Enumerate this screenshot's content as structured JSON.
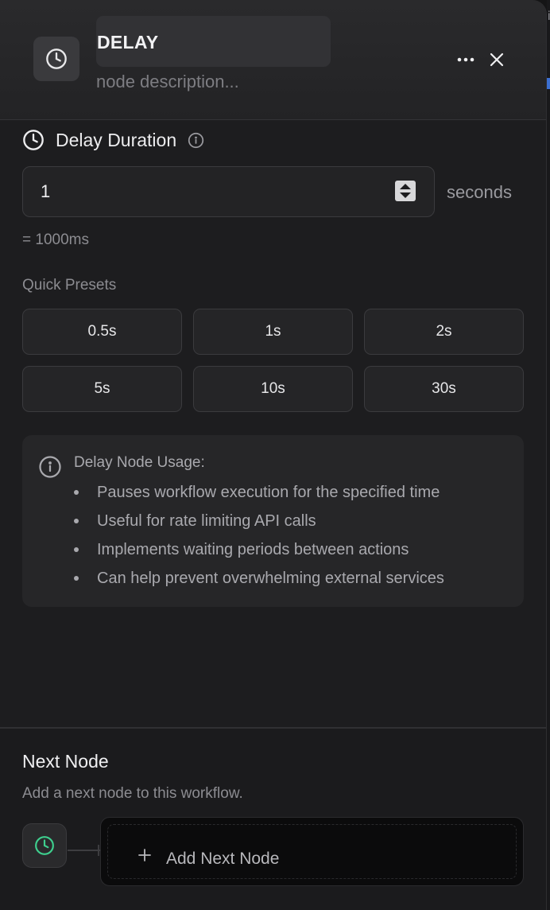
{
  "header": {
    "title": "DELAY",
    "description_placeholder": "node description...",
    "icon": "clock-icon",
    "more_icon": "ellipsis-icon",
    "close_icon": "close-icon"
  },
  "delay": {
    "section_title": "Delay Duration",
    "value": "1",
    "unit": "seconds",
    "ms_text": "= 1000ms"
  },
  "presets": {
    "label": "Quick Presets",
    "items": [
      "0.5s",
      "1s",
      "2s",
      "5s",
      "10s",
      "30s"
    ]
  },
  "usage": {
    "title": "Delay Node Usage:",
    "items": [
      "Pauses workflow execution for the specified time",
      "Useful for rate limiting API calls",
      "Implements waiting periods between actions",
      "Can help prevent overwhelming external services"
    ]
  },
  "next_node": {
    "title": "Next Node",
    "subtitle": "Add a next node to this workflow.",
    "add_label": "Add Next Node",
    "node_icon": "clock-icon",
    "node_icon_color": "#3ecf8e"
  },
  "colors": {
    "panel_bg": "#1d1d1f",
    "accent_green": "#3ecf8e"
  }
}
